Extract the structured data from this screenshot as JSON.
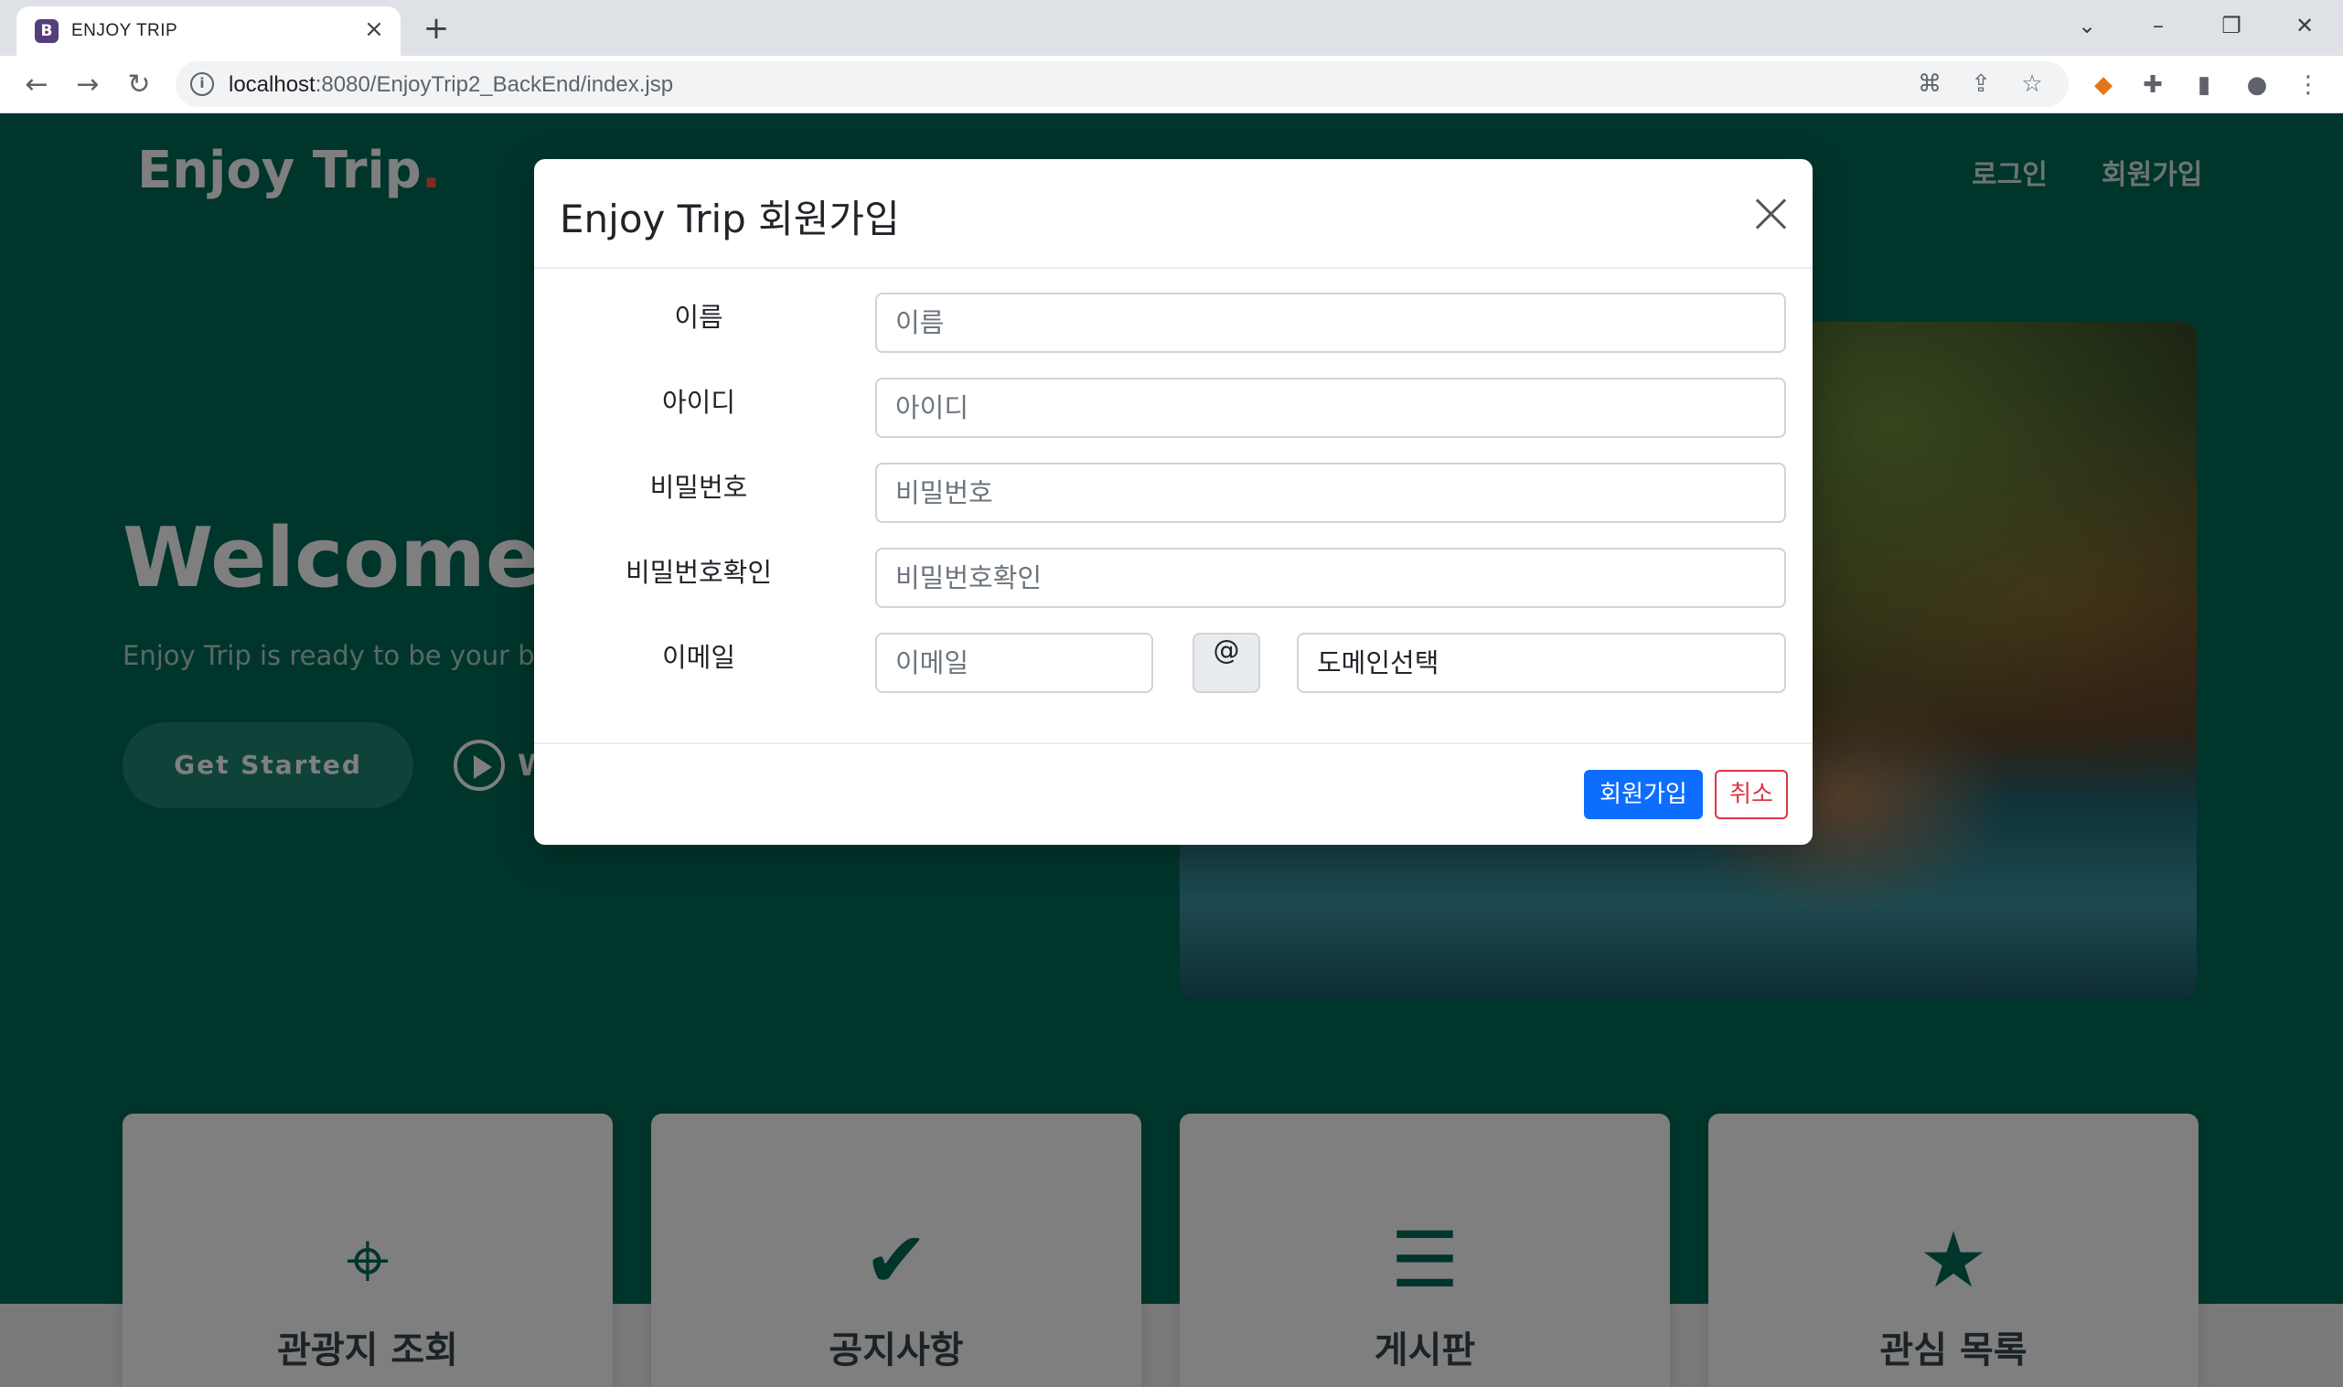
{
  "browser": {
    "tab_favicon": "B",
    "tab_title": "ENJOY TRIP",
    "url_host": "localhost",
    "url_rest": ":8080/EnjoyTrip2_BackEnd/index.jsp"
  },
  "site": {
    "logo": "Enjoy Trip",
    "logo_dot": ".",
    "nav": {
      "login": "로그인",
      "signup": "회원가입"
    },
    "hero": {
      "title": "Welcome t",
      "subtitle": "Enjoy Trip is ready to be your best",
      "cta": "Get Started",
      "watch_label": "W"
    },
    "cards": [
      {
        "icon": "map-pin-icon",
        "label": "관광지 조회"
      },
      {
        "icon": "badge-check-icon",
        "label": "공지사항"
      },
      {
        "icon": "document-icon",
        "label": "게시판"
      },
      {
        "icon": "star-icon",
        "label": "관심 목록"
      }
    ]
  },
  "modal": {
    "title": "Enjoy Trip 회원가입",
    "fields": [
      {
        "label": "이름",
        "placeholder": "이름"
      },
      {
        "label": "아이디",
        "placeholder": "아이디"
      },
      {
        "label": "비밀번호",
        "placeholder": "비밀번호"
      },
      {
        "label": "비밀번호확인",
        "placeholder": "비밀번호확인"
      }
    ],
    "email": {
      "label": "이메일",
      "placeholder": "이메일",
      "at": "@",
      "domain_selected": "도메인선택"
    },
    "buttons": {
      "submit": "회원가입",
      "cancel": "취소"
    }
  },
  "colors": {
    "brand_green": "#016b56",
    "primary": "#0d6efd",
    "danger": "#dc3545",
    "logo_dot": "#f85a40"
  }
}
